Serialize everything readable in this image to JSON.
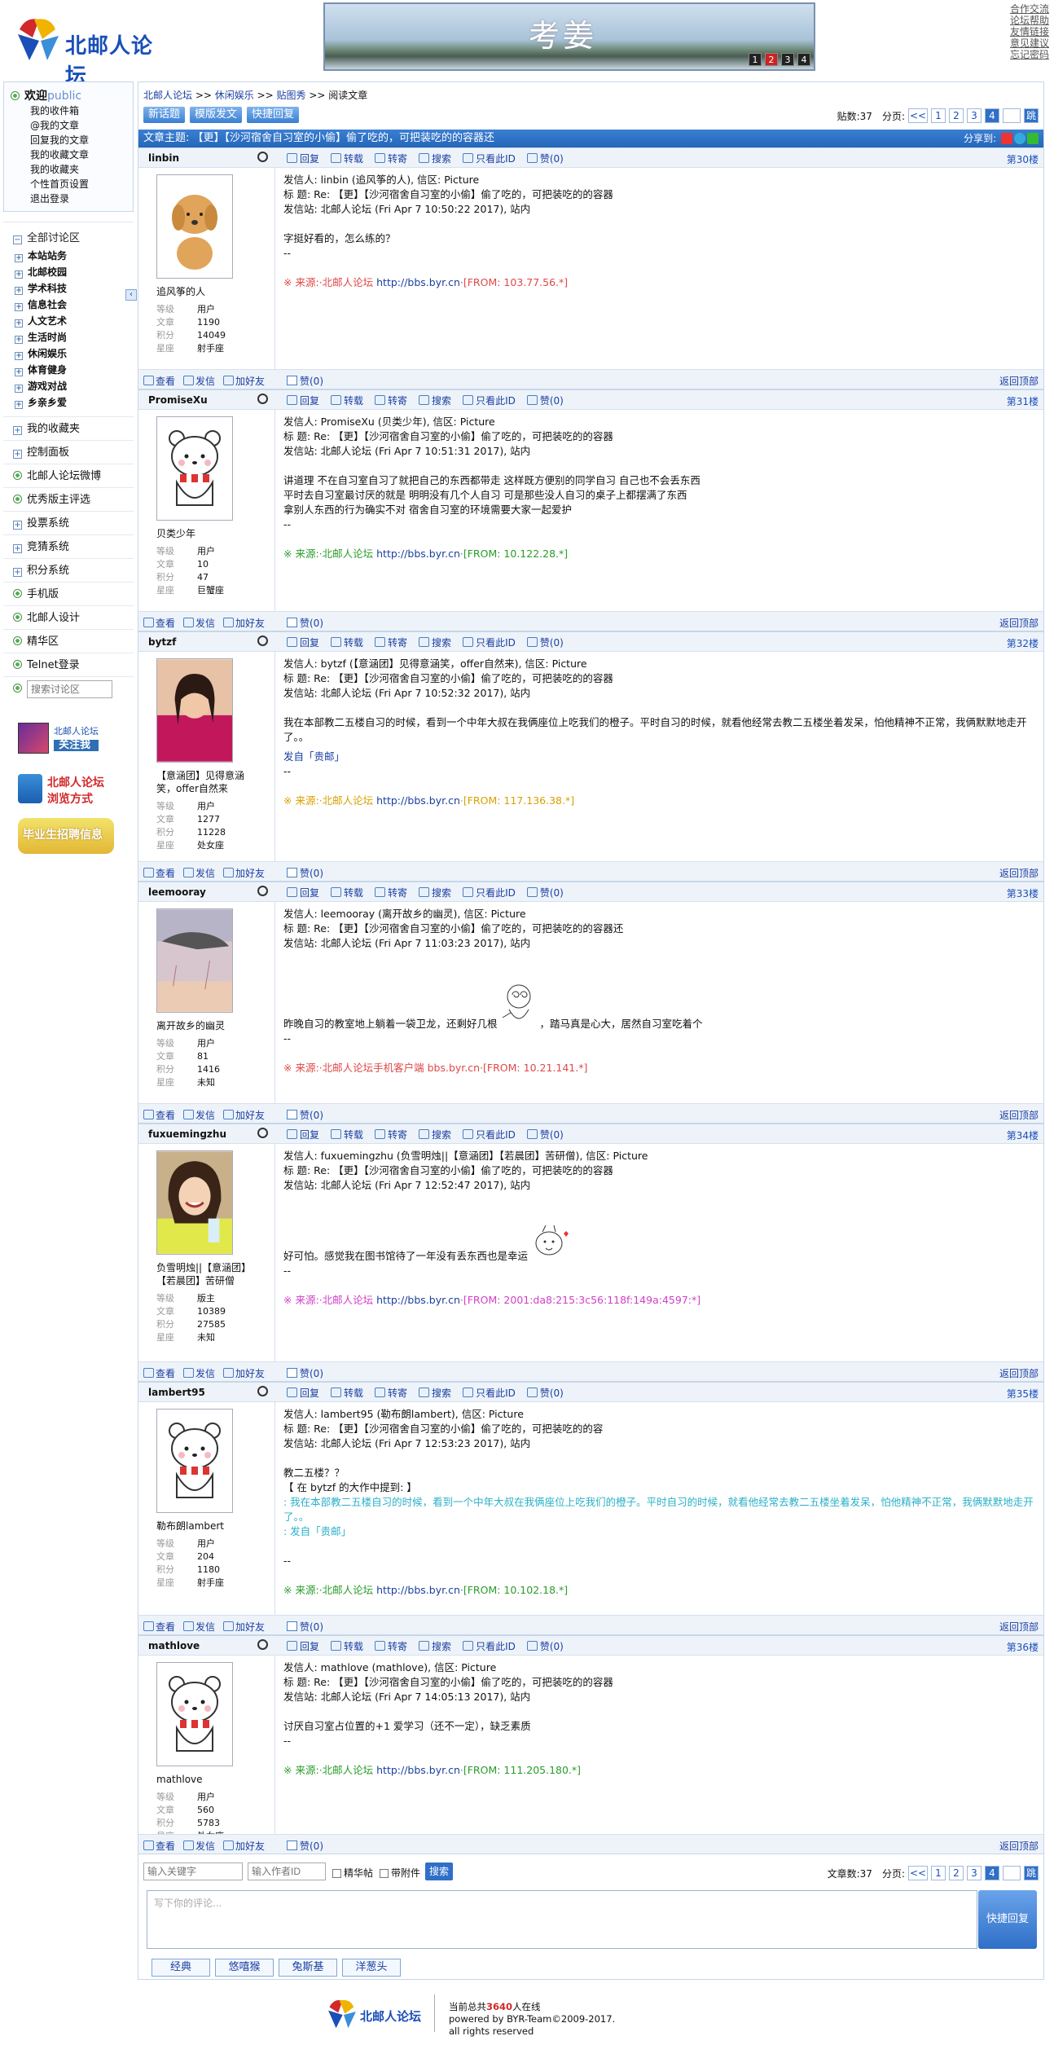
{
  "header": {
    "logo_text": "北邮人论坛",
    "banner_title": "考姜",
    "banner_pages": [
      "1",
      "2",
      "3",
      "4"
    ],
    "top_links": [
      "合作交流",
      "论坛帮助",
      "友情链接",
      "意见建议",
      "忘记密码"
    ]
  },
  "sidebar": {
    "welcome": "欢迎",
    "user": "public",
    "menu": [
      "我的收件箱",
      "@我的文章",
      "回复我的文章",
      "我的收藏文章",
      "我的收藏夹",
      "个性首页设置",
      "退出登录"
    ],
    "all_boards": "全部讨论区",
    "boards": [
      "本站站务",
      "北邮校园",
      "学术科技",
      "信息社会",
      "人文艺术",
      "生活时尚",
      "休闲娱乐",
      "体育健身",
      "游戏对战",
      "乡亲乡爱"
    ],
    "items": [
      "我的收藏夹",
      "控制面板",
      "北邮人论坛微博",
      "优秀版主评选",
      "投票系统",
      "竞猜系统",
      "积分系统",
      "手机版",
      "北邮人设计",
      "精华区",
      "Telnet登录"
    ],
    "search_placeholder": "搜索讨论区",
    "promo1_top": "北邮人论坛",
    "promo1_btn": "关注我",
    "promo2_line1": "北邮人论坛",
    "promo2_line2": "浏览方式",
    "promo3": "毕业生招聘信息"
  },
  "crumb": [
    "北邮人论坛",
    "休闲娱乐",
    "贴图秀",
    "阅读文章"
  ],
  "actions": [
    "新话题",
    "模版发文",
    "快捷回复"
  ],
  "pager": {
    "count_label": "贴数:37",
    "page_label": "分页:",
    "prev": "<<",
    "pages": [
      "1",
      "2",
      "3",
      "4"
    ],
    "current": "4",
    "go": "跳"
  },
  "topic": {
    "title": "文章主题: 【更】【沙河宿舍自习室的小偷】偷了吃的，可把装吃的的容器还",
    "share": "分享到:"
  },
  "tools": [
    "回复",
    "转载",
    "转寄",
    "搜索",
    "只看此ID",
    "赞(0)"
  ],
  "foot_tools": [
    "查看",
    "发信",
    "加好友"
  ],
  "like": "赞(0)",
  "totop": "返回顶部",
  "stat_keys": [
    "等级",
    "文章",
    "积分",
    "星座"
  ],
  "posts": [
    {
      "id": "linbin",
      "floor": "第30楼",
      "nick": "追风筝的人",
      "stats": [
        "用户",
        "1190",
        "14049",
        "射手座"
      ],
      "lines": [
        "发信人: linbin (追风筝的人), 信区: Picture",
        "标  题: Re: 【更】【沙河宿舍自习室的小偷】偷了吃的，可把装吃的的容器",
        "发信站: 北邮人论坛 (Fri Apr  7 10:50:22 2017), 站内"
      ],
      "body": [
        "字挺好看的，怎么练的？",
        "--"
      ],
      "src_label": "※ 来源:·北邮人论坛",
      "src_link": "http://bbs.byr.cn",
      "src_ip": "·[FROM: 103.77.56.*]"
    },
    {
      "id": "PromiseXu",
      "floor": "第31楼",
      "nick": "贝类少年",
      "stats": [
        "用户",
        "10",
        "47",
        "巨蟹座"
      ],
      "lines": [
        "发信人: PromiseXu (贝类少年), 信区: Picture",
        "标  题: Re: 【更】【沙河宿舍自习室的小偷】偷了吃的，可把装吃的的容器",
        "发信站: 北邮人论坛 (Fri Apr  7 10:51:31 2017), 站内"
      ],
      "body": [
        "讲道理 不在自习室自习了就把自己的东西都带走 这样既方便别的同学自习 自己也不会丢东西",
        "平时去自习室最讨厌的就是 明明没有几个人自习 可是那些没人自习的桌子上都摆满了东西",
        "拿别人东西的行为确实不对 宿舍自习室的环境需要大家一起爱护",
        "--"
      ],
      "src_label": "※ 来源:·北邮人论坛",
      "src_link": "http://bbs.byr.cn",
      "src_ip": "·[FROM: 10.122.28.*]"
    },
    {
      "id": "bytzf",
      "floor": "第32楼",
      "nick": "【意涵团】见得意涵笑，offer自然来",
      "stats": [
        "用户",
        "1277",
        "11228",
        "处女座"
      ],
      "lines": [
        "发信人: bytzf (【意涵团】见得意涵笑，offer自然来), 信区: Picture",
        "标  题: Re: 【更】【沙河宿舍自习室的小偷】偷了吃的，可把装吃的的容器",
        "发信站: 北邮人论坛 (Fri Apr  7 10:52:32 2017), 站内"
      ],
      "body": [
        "我在本部教二五楼自习的时候，看到一个中年大叔在我俩座位上吃我们的橙子。平时自习的时候，就看他经常去教二五楼坐着发呆，怕他精神不正常，我俩默默地走开了。。",
        "发自「贵邮」",
        "--"
      ],
      "src_label": "※ 来源:·北邮人论坛",
      "src_link": "http://bbs.byr.cn",
      "src_ip": "·[FROM: 117.136.38.*]"
    },
    {
      "id": "leemooray",
      "floor": "第33楼",
      "nick": "离开故乡的幽灵",
      "stats": [
        "用户",
        "81",
        "1416",
        "未知"
      ],
      "lines": [
        "发信人: leemooray (离开故乡的幽灵), 信区: Picture",
        "标  题: Re: 【更】【沙河宿舍自习室的小偷】偷了吃的，可把装吃的的容器还",
        "发信站: 北邮人论坛 (Fri Apr  7 11:03:23 2017), 站内"
      ],
      "body_a": "昨晚自习的教室地上躺着一袋卫龙，还剩好几根",
      "body_b": "，踏马真是心大，居然自习室吃着个",
      "body": [
        "--"
      ],
      "src_label": "※ 来源:·北邮人论坛手机客户端",
      "src_link": "bbs.byr.cn",
      "src_ip": "·[FROM: 10.21.141.*]"
    },
    {
      "id": "fuxuemingzhu",
      "floor": "第34楼",
      "nick": "负雪明烛||【意涵团】【若晨团】苦研僧",
      "stats": [
        "版主",
        "10389",
        "27585",
        "未知"
      ],
      "lines": [
        "发信人: fuxuemingzhu (负雪明烛||【意涵团】【若晨团】苦研僧), 信区: Picture",
        "标  题: Re: 【更】【沙河宿舍自习室的小偷】偷了吃的，可把装吃的的容器",
        "发信站: 北邮人论坛 (Fri Apr  7 12:52:47 2017), 站内"
      ],
      "body_a": "好可怕。感觉我在图书馆待了一年没有丢东西也是幸运",
      "body": [
        "--"
      ],
      "src_label": "※ 来源:·北邮人论坛",
      "src_link": "http://bbs.byr.cn",
      "src_ip": "·[FROM: 2001:da8:215:3c56:118f:149a:4597:*]"
    },
    {
      "id": "lambert95",
      "floor": "第35楼",
      "nick": "勒布朗lambert",
      "stats": [
        "用户",
        "204",
        "1180",
        "射手座"
      ],
      "lines": [
        "发信人: lambert95 (勒布朗lambert), 信区: Picture",
        "标  题: Re: 【更】【沙河宿舍自习室的小偷】偷了吃的，可把装吃的的容",
        "发信站: 北邮人论坛 (Fri Apr  7 12:53:23 2017), 站内"
      ],
      "body": [
        "教二五楼？？",
        "【 在 bytzf 的大作中提到: 】"
      ],
      "quote": [
        ": 我在本部教二五楼自习的时候，看到一个中年大叔在我俩座位上吃我们的橙子。平时自习的时候，就看他经常去教二五楼坐着发呆，怕他精神不正常，我俩默默地走开了。。",
        ": 发自「贵邮」"
      ],
      "tail": "--",
      "src_label": "※ 来源:·北邮人论坛",
      "src_link": "http://bbs.byr.cn",
      "src_ip": "·[FROM: 10.102.18.*]"
    },
    {
      "id": "mathlove",
      "floor": "第36楼",
      "nick": "mathlove",
      "stats": [
        "用户",
        "560",
        "5783",
        "处女座"
      ],
      "lines": [
        "发信人: mathlove (mathlove), 信区: Picture",
        "标  题: Re: 【更】【沙河宿舍自习室的小偷】偷了吃的，可把装吃的的容器",
        "发信站: 北邮人论坛 (Fri Apr  7 14:05:13 2017), 站内"
      ],
      "body": [
        "讨厌自习室占位置的+1  爱学习（还不一定），缺乏素质",
        "--"
      ],
      "src_label": "※ 来源:·北邮人论坛",
      "src_link": "http://bbs.byr.cn",
      "src_ip": "·[FROM: 111.205.180.*]"
    }
  ],
  "bottom": {
    "kw_placeholder": "输入关键字",
    "author_placeholder": "输入作者ID",
    "digest": "精华帖",
    "attach": "带附件",
    "search": "搜索",
    "count_label": "文章数:37"
  },
  "reply": {
    "placeholder": "写下你的评论...",
    "button": "快捷回复",
    "emotes": [
      "经典",
      "悠嘻猴",
      "兔斯基",
      "洋葱头"
    ]
  },
  "footer": {
    "online_pre": "当前总共",
    "online_num": "3640",
    "online_post": "人在线",
    "powered": "powered by BYR-Team©2009-2017.",
    "rights": "all rights reserved",
    "logo_text": "北邮人论坛"
  },
  "colors": {
    "accent": "#2f6fc8",
    "title_bar": "#2566b8",
    "source_red": "#e04848",
    "source_green": "#2a9c2a"
  }
}
